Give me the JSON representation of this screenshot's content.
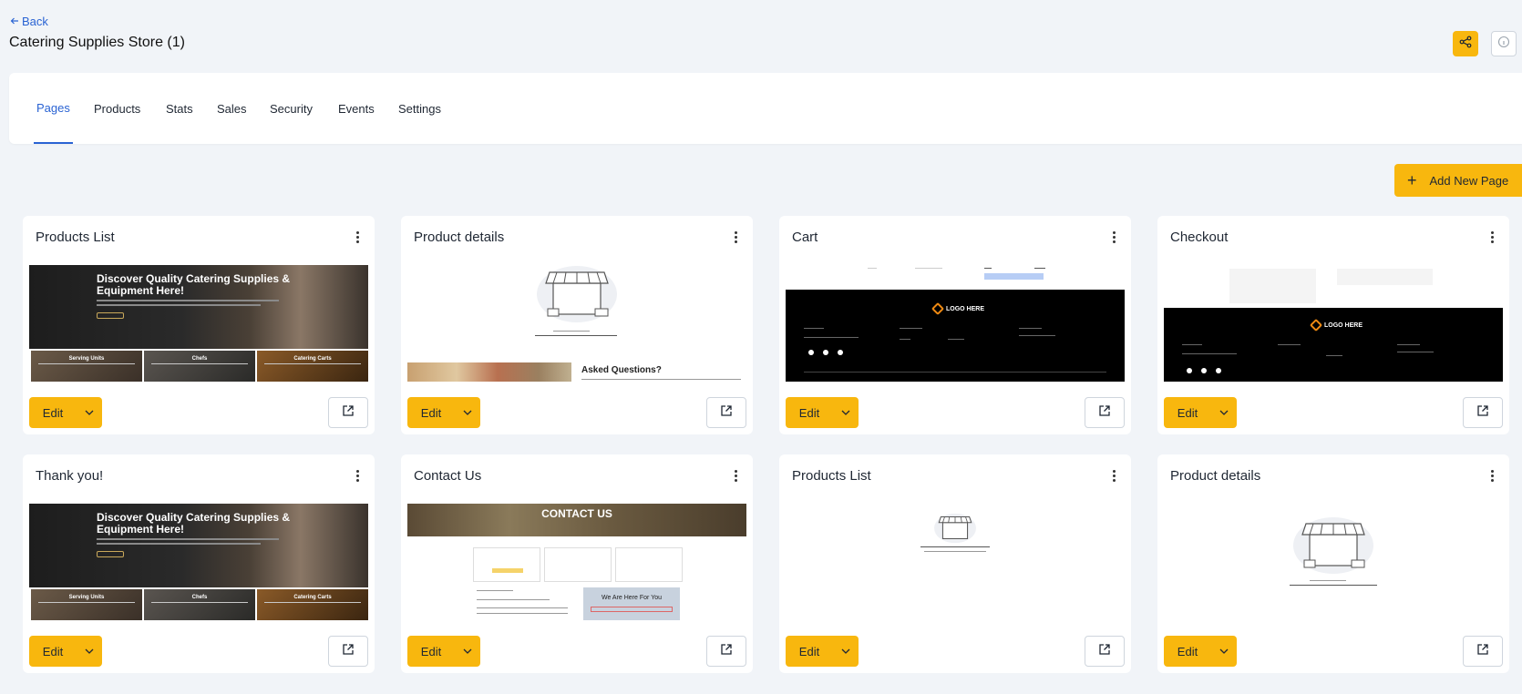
{
  "header": {
    "back_label": "Back",
    "title": "Catering Supplies Store (1)"
  },
  "tabs": [
    {
      "label": "Pages",
      "active": true
    },
    {
      "label": "Products",
      "active": false
    },
    {
      "label": "Stats",
      "active": false
    },
    {
      "label": "Sales",
      "active": false
    },
    {
      "label": "Security",
      "active": false
    },
    {
      "label": "Events",
      "active": false
    },
    {
      "label": "Settings",
      "active": false
    }
  ],
  "actions": {
    "add_page_label": "Add New Page"
  },
  "cards": [
    {
      "title": "Products List",
      "edit_label": "Edit",
      "thumbnail": "hero-catering"
    },
    {
      "title": "Product details",
      "edit_label": "Edit",
      "thumbnail": "store-faq"
    },
    {
      "title": "Cart",
      "edit_label": "Edit",
      "thumbnail": "cart-footer"
    },
    {
      "title": "Checkout",
      "edit_label": "Edit",
      "thumbnail": "checkout-footer"
    },
    {
      "title": "Thank you!",
      "edit_label": "Edit",
      "thumbnail": "hero-catering"
    },
    {
      "title": "Contact Us",
      "edit_label": "Edit",
      "thumbnail": "contact"
    },
    {
      "title": "Products List",
      "edit_label": "Edit",
      "thumbnail": "store-small"
    },
    {
      "title": "Product details",
      "edit_label": "Edit",
      "thumbnail": "store-medium"
    }
  ],
  "thumb_text": {
    "hero_heading": "Discover Quality Catering Supplies & Equipment Here!",
    "tile_serving": "Serving Units",
    "tile_chefs": "Chefs",
    "tile_carts": "Catering Carts",
    "faq_heading": "Asked Questions?",
    "logo_text": "LOGO HERE",
    "contact_heading": "CONTACT US",
    "contact_help": "We Are Here For You"
  },
  "colors": {
    "accent": "#f8b70e",
    "link": "#2a63d3",
    "background": "#f1f4f8"
  }
}
